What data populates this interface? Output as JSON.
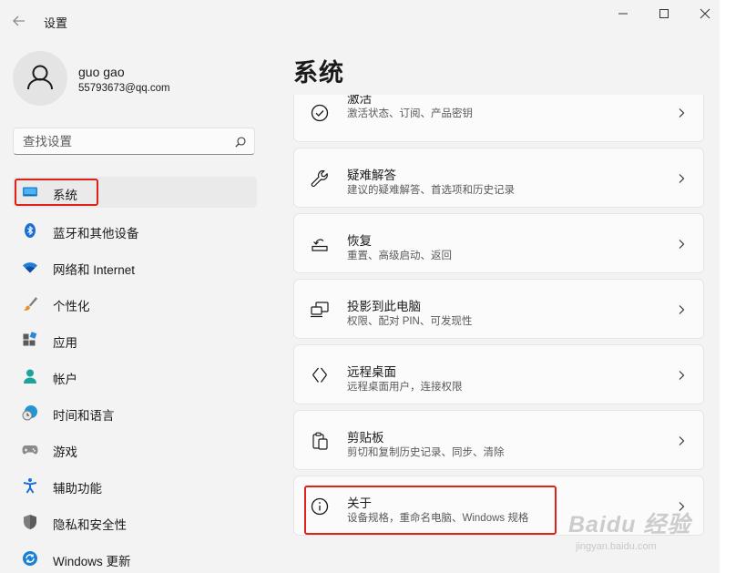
{
  "window": {
    "title": "设置"
  },
  "user": {
    "name": "guo gao",
    "email": "55793673@qq.com"
  },
  "search": {
    "placeholder": "查找设置"
  },
  "nav": {
    "items": [
      {
        "label": "系统",
        "icon": "system-display-icon",
        "selected": true
      },
      {
        "label": "蓝牙和其他设备",
        "icon": "bluetooth-icon"
      },
      {
        "label": "网络和 Internet",
        "icon": "wifi-icon"
      },
      {
        "label": "个性化",
        "icon": "brush-icon"
      },
      {
        "label": "应用",
        "icon": "apps-icon"
      },
      {
        "label": "帐户",
        "icon": "person-icon"
      },
      {
        "label": "时间和语言",
        "icon": "globe-clock-icon"
      },
      {
        "label": "游戏",
        "icon": "gamepad-icon"
      },
      {
        "label": "辅助功能",
        "icon": "accessibility-icon"
      },
      {
        "label": "隐私和安全性",
        "icon": "shield-icon"
      },
      {
        "label": "Windows 更新",
        "icon": "update-icon"
      }
    ]
  },
  "page": {
    "title": "系统"
  },
  "settings": [
    {
      "title": "激活",
      "subtitle": "激活状态、订阅、产品密钥",
      "icon": "check-circle-icon"
    },
    {
      "title": "疑难解答",
      "subtitle": "建议的疑难解答、首选项和历史记录",
      "icon": "wrench-icon"
    },
    {
      "title": "恢复",
      "subtitle": "重置、高级启动、返回",
      "icon": "recovery-icon"
    },
    {
      "title": "投影到此电脑",
      "subtitle": "权限、配对 PIN、可发现性",
      "icon": "project-icon"
    },
    {
      "title": "远程桌面",
      "subtitle": "远程桌面用户，连接权限",
      "icon": "remote-desktop-icon"
    },
    {
      "title": "剪贴板",
      "subtitle": "剪切和复制历史记录、同步、清除",
      "icon": "clipboard-icon"
    },
    {
      "title": "关于",
      "subtitle": "设备规格，重命名电脑、Windows 规格",
      "icon": "info-icon"
    }
  ],
  "watermark": {
    "main": "Baidu 经验",
    "sub": "jingyan.baidu.com"
  },
  "colors": {
    "accent": "#0067c0",
    "highlight": "#e0211b",
    "window_bg": "#f3f3f3",
    "card_bg": "#fbfbfb"
  }
}
